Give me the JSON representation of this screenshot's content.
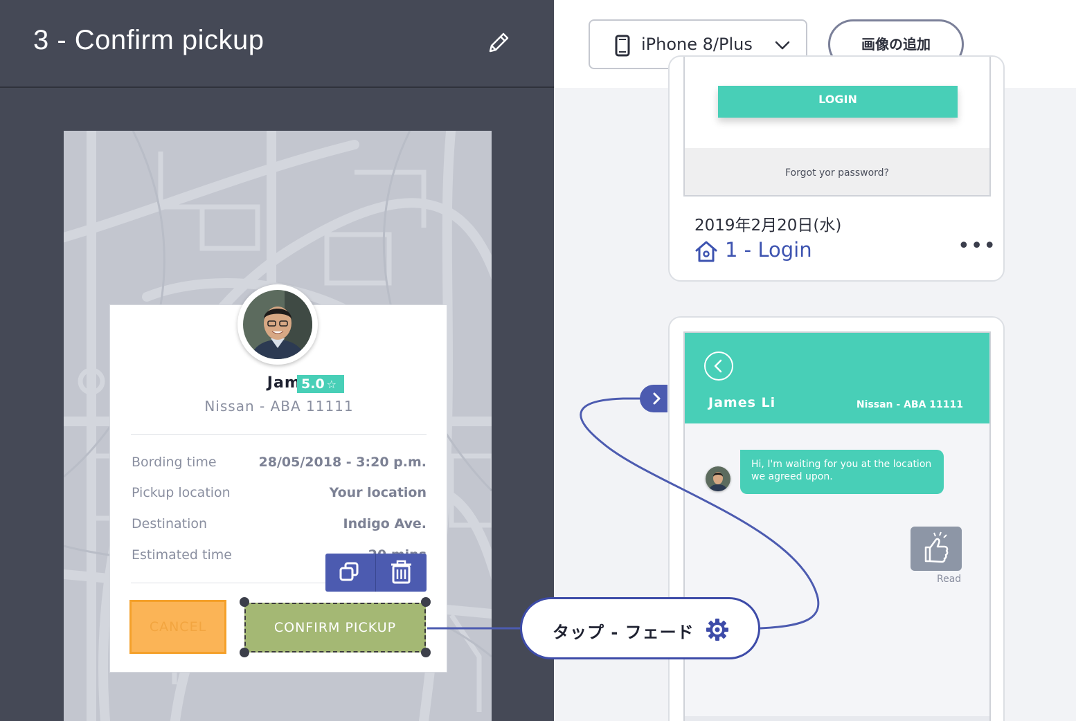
{
  "editor": {
    "screen_title": "3 - Confirm pickup"
  },
  "driver_card": {
    "name": "James Li",
    "rating": "5.0",
    "rating_star": "☆",
    "car": "Nissan - ABA 11111",
    "rows": [
      {
        "label": "Bording time",
        "value": "28/05/2018 - 3:20 p.m."
      },
      {
        "label": "Pickup location",
        "value": "Your location"
      },
      {
        "label": "Destination",
        "value": "Indigo Ave."
      },
      {
        "label": "Estimated time",
        "value": "20 mins"
      }
    ],
    "cancel_label": "CANCEL",
    "confirm_label": "CONFIRM PICKUP"
  },
  "toolbar": {
    "device_name": "iPhone 8/Plus",
    "add_image_label": "画像の追加"
  },
  "screen_login": {
    "login_button": "LOGIN",
    "forgot_text": "Forgot yor password?",
    "date": "2019年2月20日(水)",
    "name": "1 - Login",
    "more": "•••"
  },
  "screen_chat": {
    "driver_name": "James Li",
    "car": "Nissan - ABA 11111",
    "message": "Hi, I'm waiting for you at the location we agreed upon.",
    "read_label": "Read"
  },
  "transition": {
    "label": "タップ - フェード"
  },
  "colors": {
    "accent_teal": "#48cfb7",
    "accent_blue": "#4c5bb0",
    "panel_dark": "#454956",
    "cancel_orange": "#fbb456",
    "confirm_green": "#a4b874"
  },
  "icons": [
    "pencil-icon",
    "copy-icon",
    "trash-icon",
    "phone-icon",
    "chevron-down-icon",
    "home-icon",
    "chevron-left-icon",
    "chevron-right-icon",
    "thumbs-up-icon",
    "gear-icon"
  ]
}
